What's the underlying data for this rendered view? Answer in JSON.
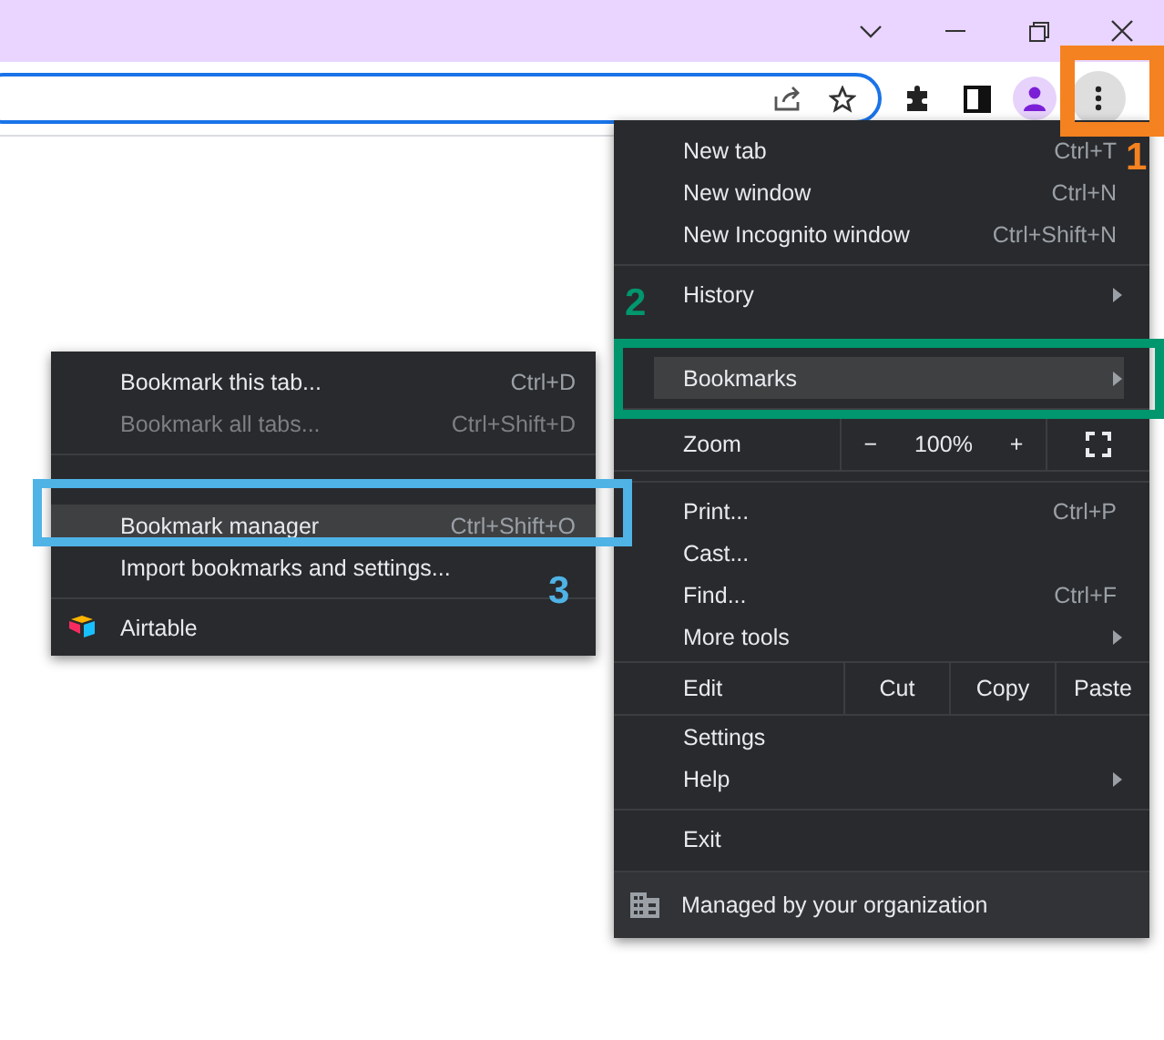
{
  "menu": {
    "items": [
      {
        "kind": "item",
        "label": "New tab",
        "shortcut": "Ctrl+T",
        "submenu": false,
        "selected": false
      },
      {
        "kind": "item",
        "label": "New window",
        "shortcut": "Ctrl+N",
        "submenu": false,
        "selected": false
      },
      {
        "kind": "item",
        "label": "New Incognito window",
        "shortcut": "Ctrl+Shift+N",
        "submenu": false,
        "selected": false
      },
      {
        "kind": "separator"
      },
      {
        "kind": "item",
        "label": "History",
        "submenu": true,
        "selected": false
      },
      {
        "kind": "covered"
      },
      {
        "kind": "item",
        "label": "Bookmarks",
        "submenu": true,
        "selected": true
      },
      {
        "kind": "separator"
      },
      {
        "kind": "zoom",
        "label": "Zoom",
        "minus": "−",
        "value": "100%",
        "plus": "+"
      },
      {
        "kind": "separator"
      },
      {
        "kind": "item",
        "label": "Print...",
        "shortcut": "Ctrl+P",
        "submenu": false,
        "selected": false
      },
      {
        "kind": "item",
        "label": "Cast...",
        "submenu": false,
        "selected": false
      },
      {
        "kind": "item",
        "label": "Find...",
        "shortcut": "Ctrl+F",
        "submenu": false,
        "selected": false
      },
      {
        "kind": "item",
        "label": "More tools",
        "submenu": true,
        "selected": false
      },
      {
        "kind": "edit",
        "label": "Edit",
        "actions": [
          "Cut",
          "Copy",
          "Paste"
        ]
      },
      {
        "kind": "item",
        "label": "Settings",
        "submenu": false,
        "selected": false
      },
      {
        "kind": "item",
        "label": "Help",
        "submenu": true,
        "selected": false
      },
      {
        "kind": "separator"
      },
      {
        "kind": "item",
        "label": "Exit",
        "submenu": false,
        "selected": false
      },
      {
        "kind": "managed",
        "label": "Managed by your organization"
      }
    ]
  },
  "submenu": {
    "items": [
      {
        "kind": "item",
        "label": "Bookmark this tab...",
        "shortcut": "Ctrl+D",
        "disabled": false,
        "selected": false
      },
      {
        "kind": "item",
        "label": "Bookmark all tabs...",
        "shortcut": "Ctrl+Shift+D",
        "disabled": true,
        "selected": false
      },
      {
        "kind": "separator"
      },
      {
        "kind": "covered"
      },
      {
        "kind": "item",
        "label": "Bookmark manager",
        "shortcut": "Ctrl+Shift+O",
        "disabled": false,
        "selected": true
      },
      {
        "kind": "item",
        "label": "Import bookmarks and settings...",
        "disabled": false,
        "selected": false
      },
      {
        "kind": "separator"
      },
      {
        "kind": "bookmark",
        "label": "Airtable"
      }
    ]
  },
  "annotations": [
    {
      "label": "1",
      "color": "#f58220"
    },
    {
      "label": "2",
      "color": "#00966e"
    },
    {
      "label": "3",
      "color": "#4fb3e6"
    }
  ]
}
